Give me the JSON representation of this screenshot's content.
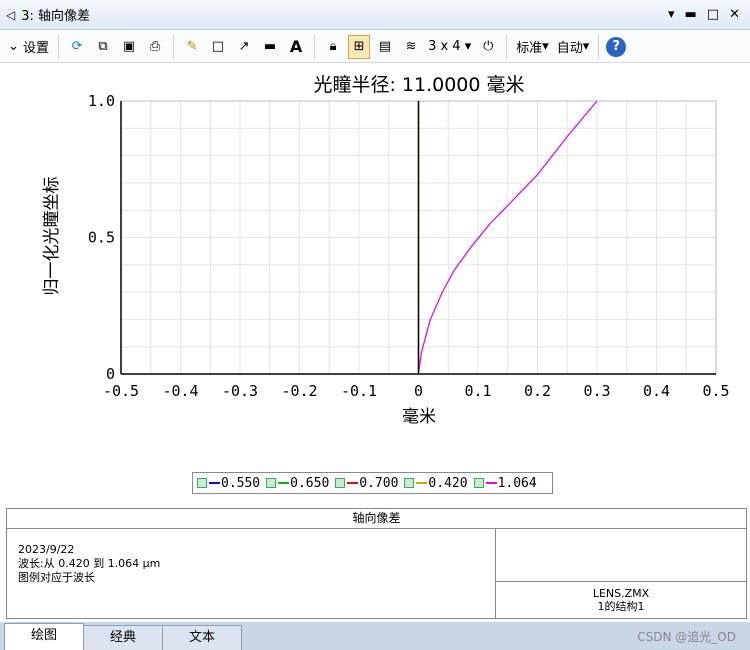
{
  "window": {
    "title": "3: 轴向像差",
    "buttons": [
      "▾",
      "▬",
      "□",
      "✕"
    ]
  },
  "toolbar": {
    "settings": "设置",
    "grid": "3 x 4",
    "standard": "标准",
    "auto": "自动"
  },
  "chart_data": {
    "type": "line",
    "title": "光瞳半径: 11.0000 毫米",
    "xlabel": "毫米",
    "ylabel": "归一化光瞳坐标",
    "xlim": [
      -0.5,
      0.5
    ],
    "ylim": [
      0,
      1.0
    ],
    "xticks": [
      "-0.5",
      "-0.4",
      "-0.3",
      "-0.2",
      "-0.1",
      "0",
      "0.1",
      "0.2",
      "0.3",
      "0.4",
      "0.5"
    ],
    "yticks": [
      "0",
      "0.5",
      "1.0"
    ],
    "series": [
      {
        "name": "0.550",
        "color": "#1010c0",
        "x": [
          0,
          0,
          0
        ],
        "y": [
          0,
          0.5,
          1.0
        ]
      },
      {
        "name": "0.650",
        "color": "#10b010",
        "x": [
          0,
          0,
          0
        ],
        "y": [
          0,
          0.5,
          1.0
        ]
      },
      {
        "name": "0.700",
        "color": "#d01010",
        "x": [
          0,
          0,
          0
        ],
        "y": [
          0,
          0.5,
          1.0
        ]
      },
      {
        "name": "0.420",
        "color": "#c8b400",
        "x": [
          0,
          0,
          0
        ],
        "y": [
          0,
          0.5,
          1.0
        ]
      },
      {
        "name": "1.064",
        "color": "#e010e0",
        "x": [
          0,
          0.005,
          0.02,
          0.04,
          0.06,
          0.09,
          0.12,
          0.16,
          0.2,
          0.25,
          0.3
        ],
        "y": [
          0,
          0.08,
          0.2,
          0.3,
          0.38,
          0.47,
          0.55,
          0.64,
          0.73,
          0.87,
          1.0
        ]
      }
    ]
  },
  "info": {
    "header": "轴向像差",
    "date": "2023/9/22",
    "wavelength": "波长:从 0.420 到 1.064 μm",
    "legend_note": "图例对应于波长",
    "file": "LENS.ZMX",
    "config": "1的结构1"
  },
  "tabs": [
    "绘图",
    "经典",
    "文本"
  ],
  "watermark": "CSDN @追光_OD"
}
